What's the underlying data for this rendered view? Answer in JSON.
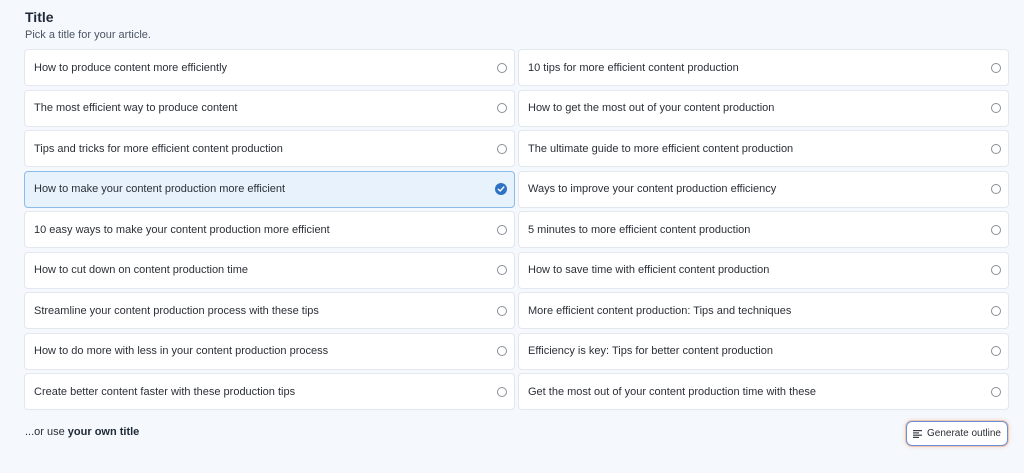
{
  "section": {
    "title": "Title",
    "subtitle": "Pick a title for your article."
  },
  "options": [
    {
      "label": "How to produce content more efficiently",
      "selected": false
    },
    {
      "label": "10 tips for more efficient content production",
      "selected": false
    },
    {
      "label": "The most efficient way to produce content",
      "selected": false
    },
    {
      "label": "How to get the most out of your content production",
      "selected": false
    },
    {
      "label": "Tips and tricks for more efficient content production",
      "selected": false
    },
    {
      "label": "The ultimate guide to more efficient content production",
      "selected": false
    },
    {
      "label": "How to make your content production more efficient",
      "selected": true
    },
    {
      "label": "Ways to improve your content production efficiency",
      "selected": false
    },
    {
      "label": "10 easy ways to make your content production more efficient",
      "selected": false
    },
    {
      "label": "5 minutes to more efficient content production",
      "selected": false
    },
    {
      "label": "How to cut down on content production time",
      "selected": false
    },
    {
      "label": "How to save time with efficient content production",
      "selected": false
    },
    {
      "label": "Streamline your content production process with these tips",
      "selected": false
    },
    {
      "label": "More efficient content production: Tips and techniques",
      "selected": false
    },
    {
      "label": "How to do more with less in your content production process",
      "selected": false
    },
    {
      "label": "Efficiency is key: Tips for better content production",
      "selected": false
    },
    {
      "label": "Create better content faster with these production tips",
      "selected": false
    },
    {
      "label": "Get the most out of your content production time with these",
      "selected": false
    }
  ],
  "own_title": {
    "prefix": "...or use ",
    "link": "your own title"
  },
  "generate_button": {
    "label": "Generate outline",
    "icon": "list-align-left-icon"
  },
  "colors": {
    "background": "#f5f8fc",
    "selected_bg": "#e8f2fc",
    "selected_border": "#8bbce9",
    "check_fill": "#2f72c4"
  }
}
